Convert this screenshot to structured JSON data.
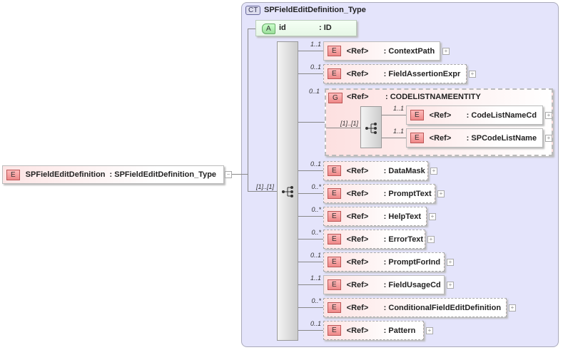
{
  "complex_type": {
    "badge": "CT",
    "name": "SPFieldEditDefinition_Type"
  },
  "attribute": {
    "badge": "A",
    "name": "id",
    "type": ": ID"
  },
  "root": {
    "badge": "E",
    "name": "SPFieldEditDefinition",
    "type": ": SPFieldEditDefinition_Type",
    "collapse": "−"
  },
  "sequence_multiplicity": "[1]..[1]",
  "group": {
    "badge": "G",
    "ref": "<Ref>",
    "name": ": CODELISTNAMEENTITY",
    "multiplicity": "0..1",
    "choice_multiplicity": "[1]..[1]",
    "children": [
      {
        "badge": "E",
        "ref": "<Ref>",
        "name": ": CodeListNameCd",
        "multiplicity": "1..1",
        "expand": "+"
      },
      {
        "badge": "E",
        "ref": "<Ref>",
        "name": ": SPCodeListName",
        "multiplicity": "1..1",
        "expand": "+"
      }
    ]
  },
  "elements": [
    {
      "badge": "E",
      "ref": "<Ref>",
      "name": ": ContextPath",
      "multiplicity": "1..1",
      "expand": "+"
    },
    {
      "badge": "E",
      "ref": "<Ref>",
      "name": ": FieldAssertionExpr",
      "multiplicity": "0..1",
      "expand": "+"
    },
    {
      "badge": "E",
      "ref": "<Ref>",
      "name": ": DataMask",
      "multiplicity": "0..1",
      "expand": "+"
    },
    {
      "badge": "E",
      "ref": "<Ref>",
      "name": ": PromptText",
      "multiplicity": "0..*",
      "expand": "+"
    },
    {
      "badge": "E",
      "ref": "<Ref>",
      "name": ": HelpText",
      "multiplicity": "0..*",
      "expand": "+"
    },
    {
      "badge": "E",
      "ref": "<Ref>",
      "name": ": ErrorText",
      "multiplicity": "0..*",
      "expand": "+"
    },
    {
      "badge": "E",
      "ref": "<Ref>",
      "name": ": PromptForInd",
      "multiplicity": "0..1",
      "expand": "+"
    },
    {
      "badge": "E",
      "ref": "<Ref>",
      "name": ": FieldUsageCd",
      "multiplicity": "1..1",
      "expand": "+"
    },
    {
      "badge": "E",
      "ref": "<Ref>",
      "name": ": ConditionalFieldEditDefinition",
      "multiplicity": "0..*",
      "expand": "+"
    },
    {
      "badge": "E",
      "ref": "<Ref>",
      "name": ": Pattern",
      "multiplicity": "0..1",
      "expand": "+"
    }
  ]
}
